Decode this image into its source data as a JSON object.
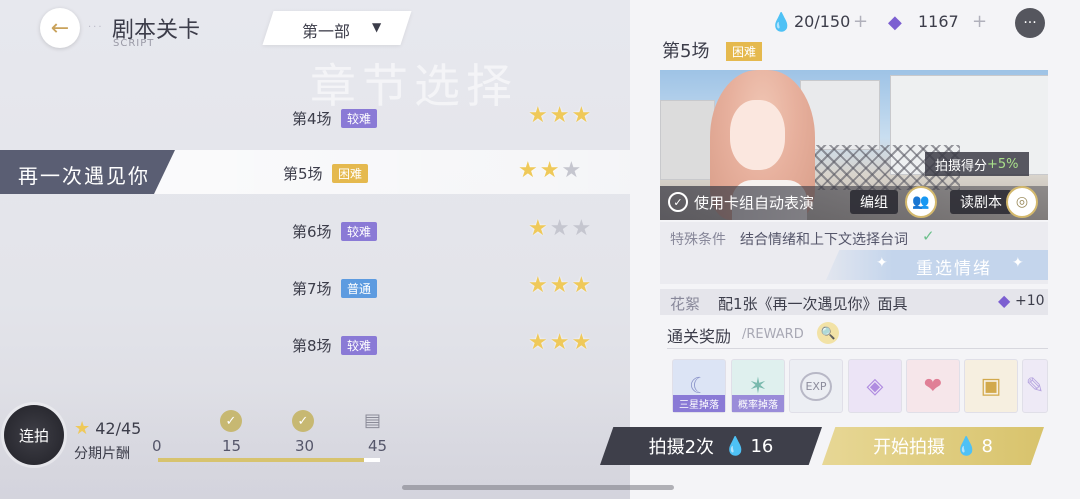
{
  "header": {
    "title": "剧本关卡",
    "subtitle": "SCRIPT",
    "part_select": "第一部",
    "watermark": "章节选择"
  },
  "chapter": {
    "name": "再一次遇见你"
  },
  "stages": [
    {
      "name": "第4场",
      "difficulty": "较难",
      "stars": 3
    },
    {
      "name": "第5场",
      "difficulty": "困难",
      "stars": 2,
      "selected": true
    },
    {
      "name": "第6场",
      "difficulty": "较难",
      "stars": 1
    },
    {
      "name": "第7场",
      "difficulty": "普通",
      "stars": 3
    },
    {
      "name": "第8场",
      "difficulty": "较难",
      "stars": 3
    }
  ],
  "bottom": {
    "combo_label": "连拍",
    "total_stars": "42/45",
    "reward_label": "分期片酬",
    "milestones": [
      "0",
      "15",
      "30",
      "45"
    ],
    "progress_fraction": 0.93
  },
  "resources": {
    "stamina": "20/150",
    "gems": "1167"
  },
  "detail": {
    "stage_title": "第5场",
    "stage_badge": "困难",
    "score_bonus_label": "拍摄得分",
    "score_bonus_value": "+5%",
    "auto_label": "使用卡组自动表演",
    "edit_label": "编组",
    "read_label": "读剧本",
    "cond_label": "特殊条件",
    "cond_text": "结合情绪和上下文选择台词",
    "reselect_label": "重选情绪",
    "extra_label": "花絮",
    "extra_text": "配1张《再一次遇见你》面具",
    "extra_count": "+10",
    "reward_title": "通关奖励",
    "reward_sub": "/REWARD",
    "reward_items": [
      {
        "icon": "moon-crystal-icon",
        "tag": "三星掉落"
      },
      {
        "icon": "star-crystal-icon",
        "tag": "概率掉落"
      },
      {
        "icon": "exp-icon",
        "tag": ""
      },
      {
        "icon": "purple-card-icon",
        "tag": ""
      },
      {
        "icon": "love-badge-icon",
        "tag": ""
      },
      {
        "icon": "gift-box-icon",
        "tag": ""
      },
      {
        "icon": "feather-icon",
        "tag": ""
      }
    ],
    "shoot_twice_label": "拍摄2次",
    "shoot_twice_cost": "16",
    "start_label": "开始拍摄",
    "start_cost": "8"
  },
  "colors": {
    "difficulty_hard": "#8a7ad6",
    "difficulty_very_hard": "#e5b94e",
    "difficulty_normal": "#5d9be0",
    "star": "#efc95a"
  }
}
